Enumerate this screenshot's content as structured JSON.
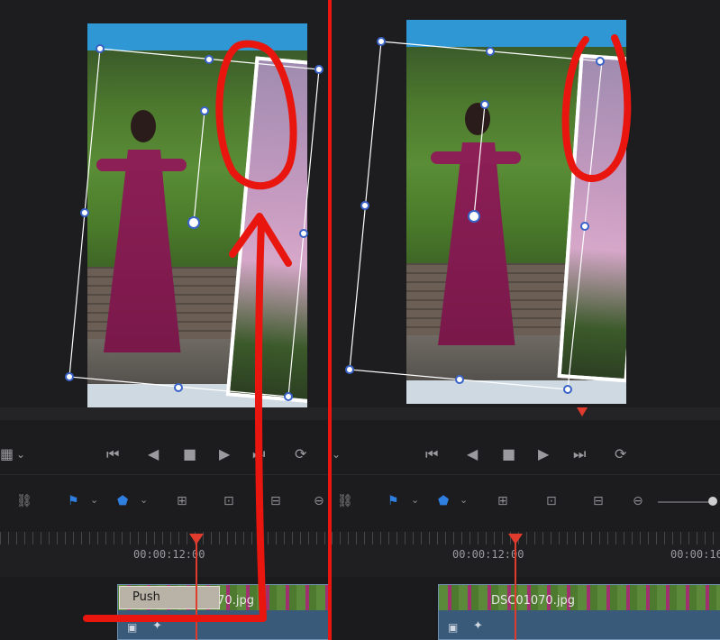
{
  "left": {
    "timecode": "00:00:12:00",
    "clip_name": "DSC01070.jpg",
    "transition_label": "Push"
  },
  "right": {
    "timecode": "00:00:12:00",
    "timecode_partial": "00:00:16:",
    "clip_name": "DSC01070.jpg"
  },
  "transport_icons": [
    "jump-to-start-icon",
    "step-back-icon",
    "stop-icon",
    "play-icon",
    "jump-to-end-icon",
    "loop-icon"
  ],
  "toolbar_icons": [
    "link-icon",
    "marker-flag-icon",
    "chevron-down-icon",
    "marker-shape-icon",
    "zoom-in-icon",
    "zoom-fit-icon",
    "zoom-out-icon"
  ],
  "colors": {
    "annotation_red": "#e8160f",
    "playhead": "#e03b2c",
    "handle_border": "#3a63c8",
    "sky": "#2f97d3"
  }
}
